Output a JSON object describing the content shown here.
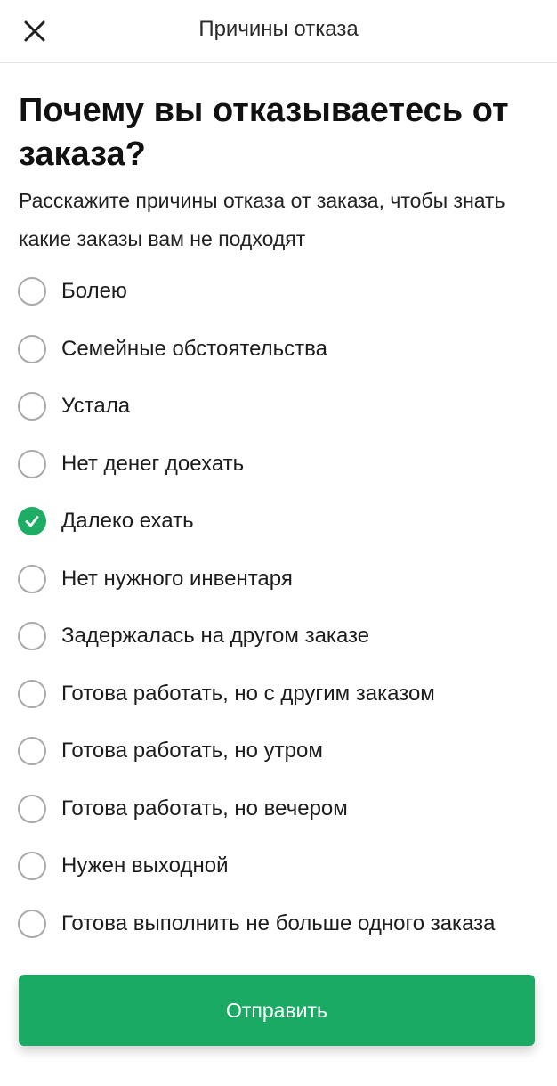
{
  "header": {
    "title": "Причины отказа",
    "close_icon": "close-icon"
  },
  "main": {
    "heading": "Почему вы отказываетесь от заказа?",
    "subtitle": "Расскажите причины отказа от заказа, чтобы знать какие заказы вам не подходят"
  },
  "reasons": [
    {
      "label": "Болею",
      "selected": false
    },
    {
      "label": "Семейные обстоятельства",
      "selected": false
    },
    {
      "label": "Устала",
      "selected": false
    },
    {
      "label": "Нет денег доехать",
      "selected": false
    },
    {
      "label": "Далеко ехать",
      "selected": true
    },
    {
      "label": "Нет нужного инвентаря",
      "selected": false
    },
    {
      "label": "Задержалась на другом заказе",
      "selected": false
    },
    {
      "label": "Готова работать, но с другим заказом",
      "selected": false
    },
    {
      "label": "Готова работать, но утром",
      "selected": false
    },
    {
      "label": "Готова работать, но вечером",
      "selected": false
    },
    {
      "label": "Нужен выходной",
      "selected": false
    },
    {
      "label": "Готова выполнить не больше одного заказа",
      "selected": false
    }
  ],
  "submit": {
    "label": "Отправить"
  },
  "colors": {
    "accent": "#1aaa64",
    "radio_border": "#a9a9a9",
    "text": "#1b1b1b"
  }
}
